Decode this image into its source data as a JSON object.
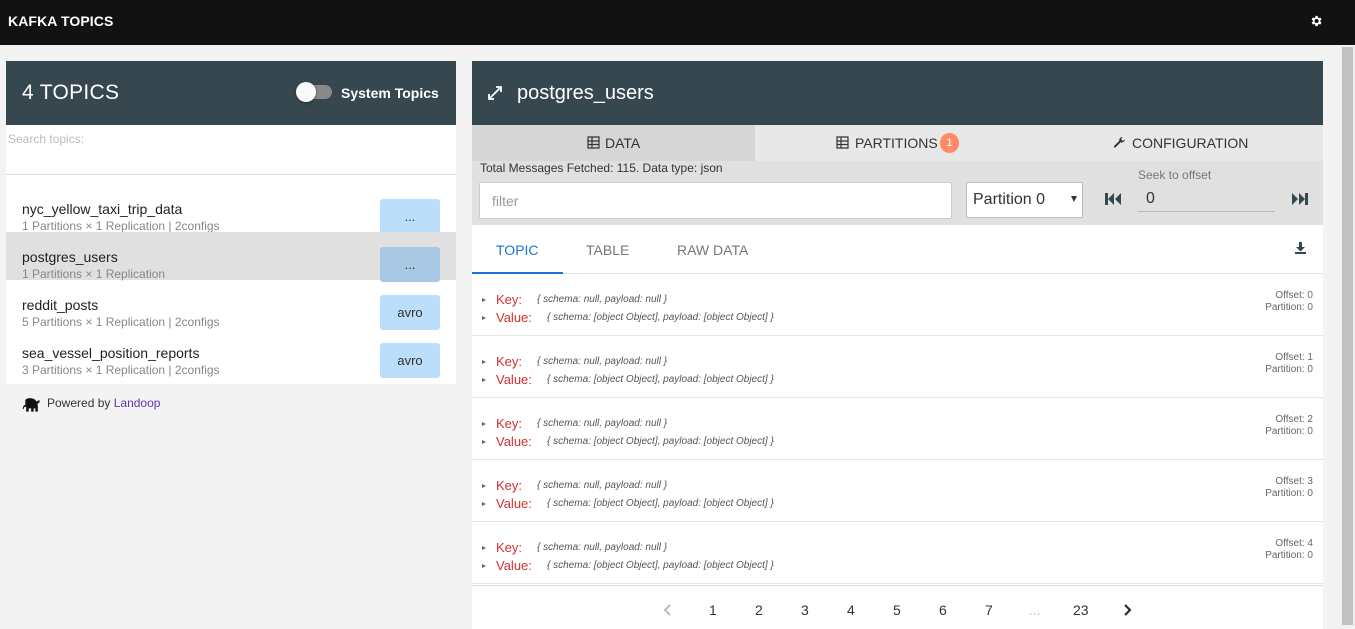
{
  "app": {
    "title": "KAFKA TOPICS"
  },
  "topics_panel": {
    "count_label": "4 TOPICS",
    "system_topics_label": "System Topics",
    "system_topics_on": false,
    "search_placeholder": "Search topics:",
    "items": [
      {
        "name": "nyc_yellow_taxi_trip_data",
        "meta": "1 Partitions × 1 Replication | 2configs",
        "badge": "...",
        "selected": false
      },
      {
        "name": "postgres_users",
        "meta": "1 Partitions × 1 Replication",
        "badge": "...",
        "selected": true
      },
      {
        "name": "reddit_posts",
        "meta": "5 Partitions × 1 Replication | 2configs",
        "badge": "avro",
        "selected": false
      },
      {
        "name": "sea_vessel_position_reports",
        "meta": "3 Partitions × 1 Replication | 2configs",
        "badge": "avro",
        "selected": false
      }
    ]
  },
  "footer": {
    "powered_by": "Powered by",
    "brand": "Landoop"
  },
  "detail": {
    "topic_name": "postgres_users",
    "tabs": [
      {
        "label": "DATA"
      },
      {
        "label": "PARTITIONS",
        "count": "1"
      },
      {
        "label": "CONFIGURATION"
      }
    ],
    "fetched_text": "Total Messages Fetched: 115. Data type: json",
    "filter_placeholder": "filter",
    "partition_select": "Partition 0",
    "seek_label": "Seek to offset",
    "seek_value": "0",
    "subtabs": [
      {
        "label": "TOPIC"
      },
      {
        "label": "TABLE"
      },
      {
        "label": "RAW DATA"
      }
    ],
    "messages": [
      {
        "key_label": "Key:",
        "key": "{ schema: null, payload: null }",
        "value_label": "Value:",
        "value": "{ schema: [object Object], payload: [object Object] }",
        "offset": "Offset: 0",
        "partition": "Partition: 0"
      },
      {
        "key_label": "Key:",
        "key": "{ schema: null, payload: null }",
        "value_label": "Value:",
        "value": "{ schema: [object Object], payload: [object Object] }",
        "offset": "Offset: 1",
        "partition": "Partition: 0"
      },
      {
        "key_label": "Key:",
        "key": "{ schema: null, payload: null }",
        "value_label": "Value:",
        "value": "{ schema: [object Object], payload: [object Object] }",
        "offset": "Offset: 2",
        "partition": "Partition: 0"
      },
      {
        "key_label": "Key:",
        "key": "{ schema: null, payload: null }",
        "value_label": "Value:",
        "value": "{ schema: [object Object], payload: [object Object] }",
        "offset": "Offset: 3",
        "partition": "Partition: 0"
      },
      {
        "key_label": "Key:",
        "key": "{ schema: null, payload: null }",
        "value_label": "Value:",
        "value": "{ schema: [object Object], payload: [object Object] }",
        "offset": "Offset: 4",
        "partition": "Partition: 0"
      }
    ],
    "pagination": {
      "pages": [
        "1",
        "2",
        "3",
        "4",
        "5",
        "6",
        "7",
        "...",
        "23"
      ]
    }
  },
  "colors": {
    "header_bg": "#37474f",
    "topbar_bg": "#121212",
    "accent_blue": "#1976d2",
    "key_red": "#d32f2f",
    "badge_blue": "#bbdefb",
    "partition_count_orange": "#ff8a65"
  },
  "icons": {
    "settings": "gear-icon",
    "expand": "expand-icon",
    "data_tab": "table-grid-icon",
    "partitions_tab": "table-grid-icon",
    "configuration_tab": "wrench-icon",
    "download": "download-icon",
    "first": "skip-back-icon",
    "last": "skip-forward-icon",
    "elephant": "elephant-icon"
  }
}
